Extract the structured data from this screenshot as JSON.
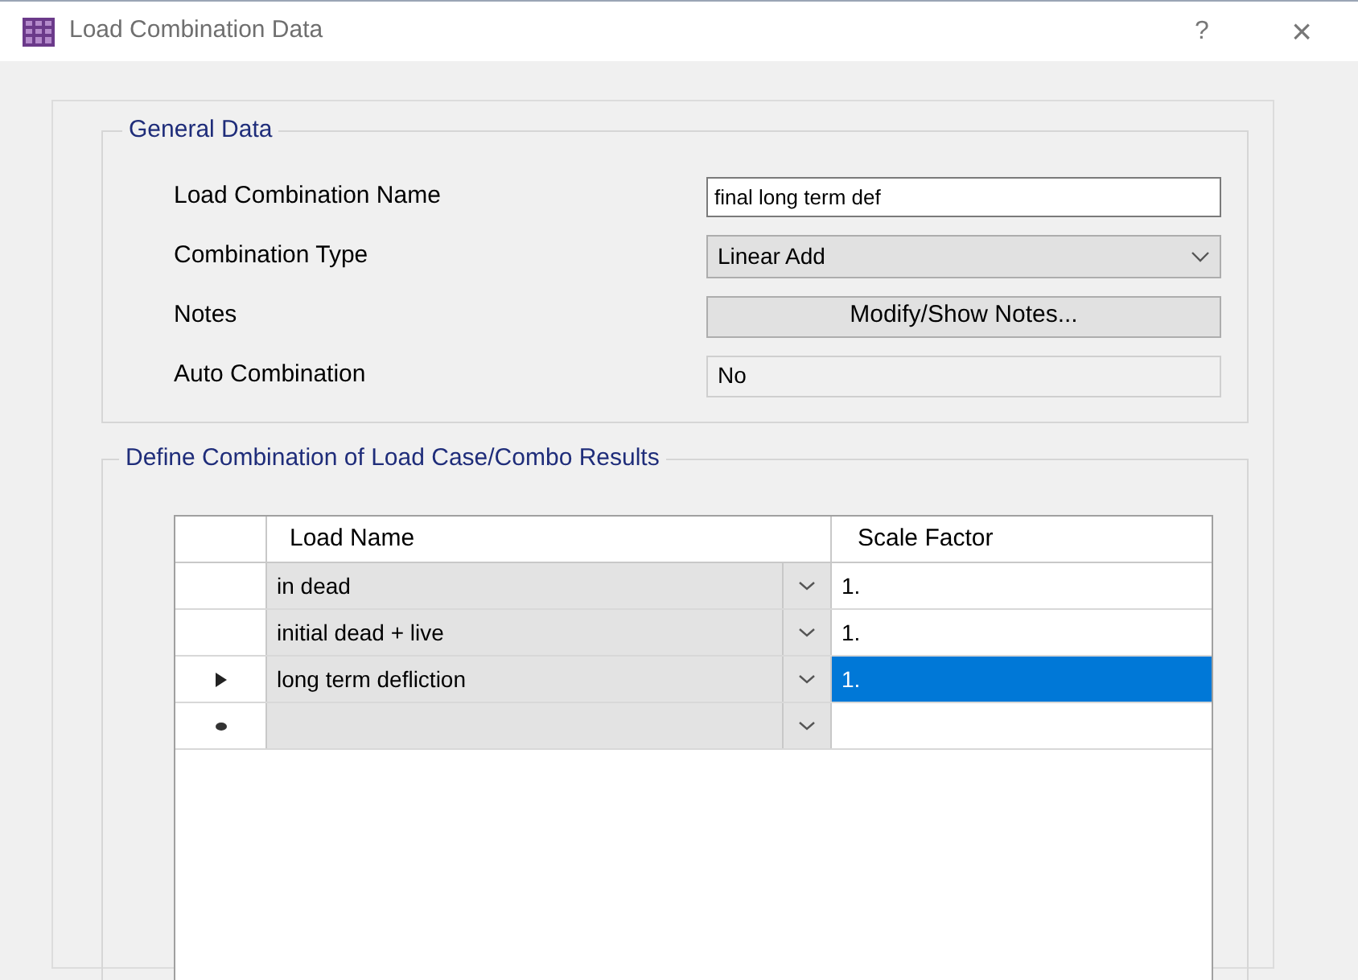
{
  "window": {
    "title": "Load Combination Data",
    "help": "?",
    "close": "×"
  },
  "general_data": {
    "legend": "General Data",
    "fields": [
      {
        "kind": "text",
        "label": "Load Combination Name",
        "value": "final long term def"
      },
      {
        "kind": "dropdown",
        "label": "Combination Type",
        "value": "Linear Add"
      },
      {
        "kind": "button",
        "label": "Notes",
        "value": "Modify/Show Notes..."
      },
      {
        "kind": "readonly",
        "label": "Auto Combination",
        "value": "No"
      }
    ]
  },
  "combination": {
    "legend": "Define Combination of Load Case/Combo Results",
    "table": {
      "columns": [
        "Load Name",
        "Scale Factor"
      ],
      "rows": [
        {
          "kind": "plain",
          "load_name": "in dead",
          "scale_factor": "1.",
          "selected": false
        },
        {
          "kind": "plain",
          "load_name": "initial dead + live",
          "scale_factor": "1.",
          "selected": false
        },
        {
          "kind": "current",
          "load_name": "long term defliction",
          "scale_factor": "1.",
          "selected": true
        },
        {
          "kind": "new",
          "selected": false
        }
      ]
    }
  }
}
